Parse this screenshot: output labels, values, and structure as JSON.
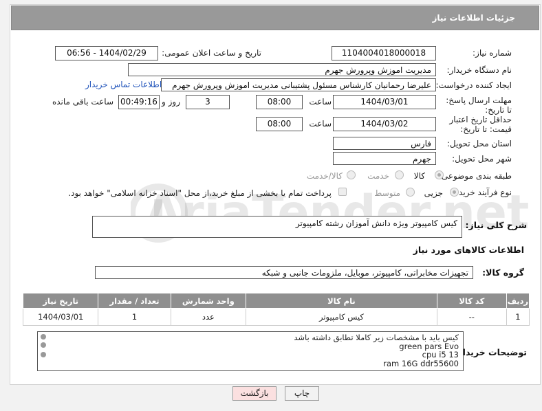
{
  "header": {
    "title": "جزئیات اطلاعات نیاز"
  },
  "fields": {
    "need_number_label": "شماره نیاز:",
    "need_number": "1104004018000018",
    "announce_label": "تاریخ و ساعت اعلان عمومی:",
    "announce_value": "1404/02/29 - 06:56",
    "buyer_org_label": "نام دستگاه خریدار:",
    "buyer_org": "مدیریت اموزش وپرورش جهرم",
    "requester_label": "ایجاد کننده درخواست:",
    "requester": "علیرضا رحمانیان کارشناس مسئول پشتیبانی مدیریت اموزش وپرورش جهرم",
    "contact_link": "اطلاعات تماس خریدار",
    "reply_deadline_label": "مهلت ارسال پاسخ: تا تاریخ:",
    "reply_date": "1404/03/01",
    "time_label": "ساعت",
    "reply_time": "08:00",
    "days_value": "3",
    "days_label": "روز و",
    "remaining_time": "00:49:16",
    "remaining_label": "ساعت باقی مانده",
    "price_validity_label": "حداقل تاریخ اعتبار قیمت: تا تاریخ:",
    "price_date": "1404/03/02",
    "price_time": "08:00",
    "province_label": "استان محل تحویل:",
    "province": "فارس",
    "city_label": "شهر محل تحویل:",
    "city": "جهرم",
    "category_label": "طبقه بندی موضوعی:",
    "category_options": [
      "کالا",
      "خدمت",
      "کالا/خدمت"
    ],
    "process_label": "نوع فرآیند خرید :",
    "process_options": [
      "جزیی",
      "متوسط"
    ],
    "payment_note": "پرداخت تمام یا بخشی از مبلغ خرید،از محل \"اسناد خزانه اسلامی\" خواهد بود."
  },
  "description": {
    "label": "شرح کلی نیاز:",
    "value": "کیس کامپیوتر ویژه دانش آموزان رشته کامپیوتر"
  },
  "goods_section": {
    "title": "اطلاعات کالاهای مورد نیاز",
    "group_label": "گروه کالا:",
    "group_value": "تجهیزات مخابراتی، کامپیوتر، موبایل، ملزومات جانبی و شبکه"
  },
  "table": {
    "headers": [
      "ردیف",
      "کد کالا",
      "نام کالا",
      "واحد شمارش",
      "تعداد / مقدار",
      "تاریخ نیاز"
    ],
    "rows": [
      [
        "1",
        "--",
        "کیس کامپیوتر",
        "عدد",
        "1",
        "1404/03/01"
      ]
    ]
  },
  "buyer_notes": {
    "label": "توضیحات خریدار:",
    "lines": [
      "کیس باید با مشخصات زیر کاملا تطابق داشته باشد",
      "green pars Evo",
      "cpu i5 13",
      "ram 16G ddr55600"
    ]
  },
  "buttons": {
    "print": "چاپ",
    "back": "بازگشت"
  },
  "watermark": {
    "text": "AriaTender.net"
  },
  "colors": {
    "header_bg": "#999999",
    "table_header_bg": "#8f8f8f",
    "link": "#2255bb",
    "back_button_bg": "#fbe0e0"
  }
}
